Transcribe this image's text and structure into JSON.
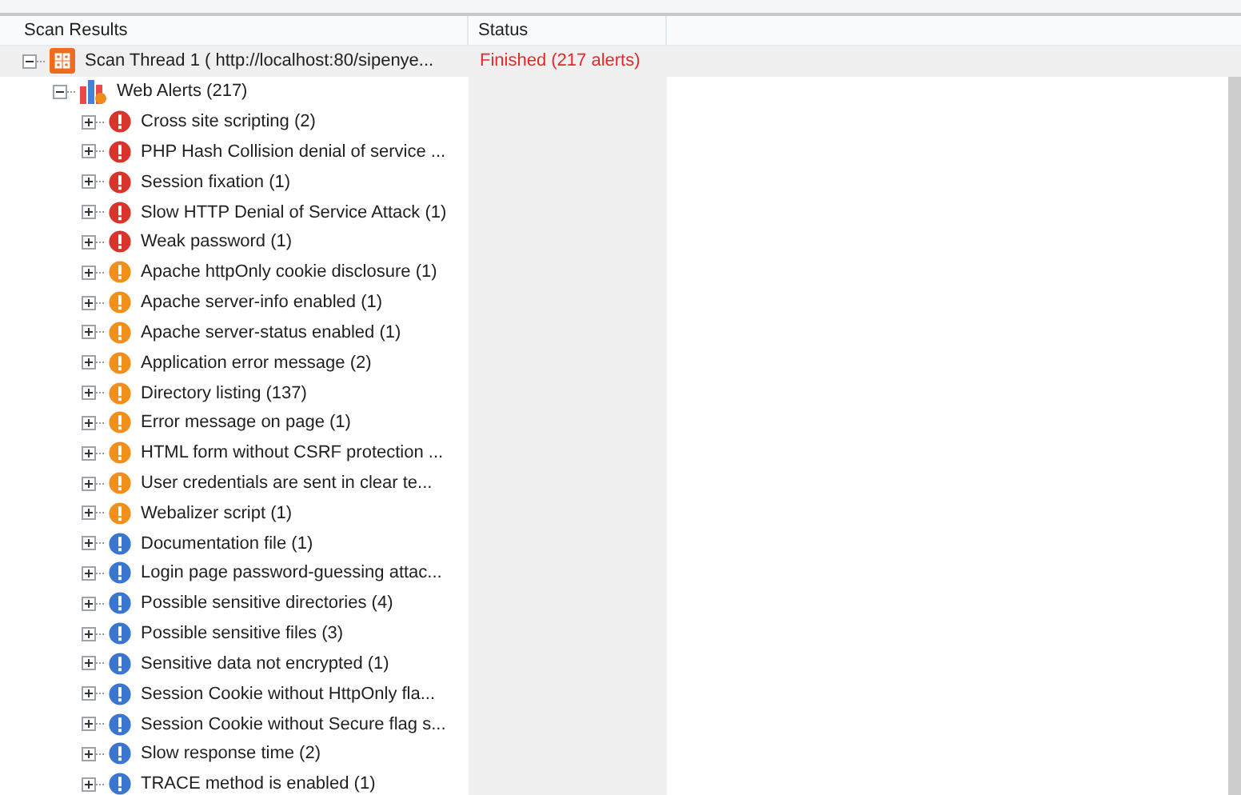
{
  "columns": [
    "Scan Results",
    "Status"
  ],
  "scan_thread": {
    "label": "Scan Thread 1 ( http://localhost:80/sipenye...",
    "status": "Finished (217 alerts)",
    "expanded": true,
    "selected": true,
    "children": [
      {
        "label": "Web Alerts (217)",
        "expanded": true,
        "children": [
          {
            "label": "Cross site scripting (2)",
            "kind": "high",
            "expanded": false
          },
          {
            "label": "PHP Hash Collision denial of service ...",
            "kind": "high",
            "expanded": false
          },
          {
            "label": "Session fixation (1)",
            "kind": "high",
            "expanded": false
          },
          {
            "label": "Slow HTTP Denial of Service Attack (1)",
            "kind": "high",
            "expanded": false
          },
          {
            "label": "Weak password (1)",
            "kind": "high",
            "expanded": false
          },
          {
            "label": "Apache httpOnly cookie disclosure (1)",
            "kind": "medium",
            "expanded": false
          },
          {
            "label": "Apache server-info enabled (1)",
            "kind": "medium",
            "expanded": false
          },
          {
            "label": "Apache server-status enabled (1)",
            "kind": "medium",
            "expanded": false
          },
          {
            "label": "Application error message (2)",
            "kind": "medium",
            "expanded": false
          },
          {
            "label": "Directory listing (137)",
            "kind": "medium",
            "expanded": false
          },
          {
            "label": "Error message on page (1)",
            "kind": "medium",
            "expanded": false
          },
          {
            "label": "HTML form without CSRF protection ...",
            "kind": "medium",
            "expanded": false
          },
          {
            "label": "User credentials are sent in clear te...",
            "kind": "medium",
            "expanded": false
          },
          {
            "label": "Webalizer script (1)",
            "kind": "medium",
            "expanded": false
          },
          {
            "label": "Documentation file (1)",
            "kind": "low",
            "expanded": false
          },
          {
            "label": "Login page password-guessing attac...",
            "kind": "low",
            "expanded": false
          },
          {
            "label": "Possible sensitive directories (4)",
            "kind": "low",
            "expanded": false
          },
          {
            "label": "Possible sensitive files (3)",
            "kind": "low",
            "expanded": false
          },
          {
            "label": "Sensitive data not encrypted (1)",
            "kind": "low",
            "expanded": false
          },
          {
            "label": "Session Cookie without HttpOnly fla...",
            "kind": "low",
            "expanded": false
          },
          {
            "label": "Session Cookie without Secure flag s...",
            "kind": "low",
            "expanded": false
          },
          {
            "label": "Slow response time (2)",
            "kind": "low",
            "expanded": false
          },
          {
            "label": "TRACE method is enabled (1)",
            "kind": "low",
            "expanded": false
          }
        ]
      }
    ]
  }
}
